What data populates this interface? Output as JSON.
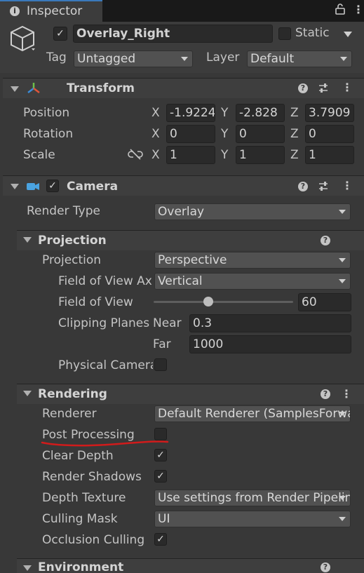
{
  "tab": {
    "title": "Inspector"
  },
  "object": {
    "name": "Overlay_Right",
    "active": true,
    "static_label": "Static",
    "static": false,
    "tag_label": "Tag",
    "tag": "Untagged",
    "layer_label": "Layer",
    "layer": "Default"
  },
  "transform": {
    "title": "Transform",
    "position": {
      "label": "Position",
      "x": "-1.9224",
      "y": "-2.828",
      "z": "3.7909"
    },
    "rotation": {
      "label": "Rotation",
      "x": "0",
      "y": "0",
      "z": "0"
    },
    "scale": {
      "label": "Scale",
      "x": "1",
      "y": "1",
      "z": "1"
    },
    "axes": {
      "x": "X",
      "y": "Y",
      "z": "Z"
    }
  },
  "camera": {
    "title": "Camera",
    "enabled": true,
    "render_type": {
      "label": "Render Type",
      "value": "Overlay"
    },
    "projection": {
      "title": "Projection",
      "projection": {
        "label": "Projection",
        "value": "Perspective"
      },
      "fov_axis": {
        "label": "Field of View Axis",
        "value": "Vertical"
      },
      "fov": {
        "label": "Field of View",
        "value": "60",
        "level": 0.39
      },
      "clipping": {
        "label": "Clipping Planes",
        "near_label": "Near",
        "near": "0.3",
        "far_label": "Far",
        "far": "1000"
      },
      "physical": {
        "label": "Physical Camera",
        "checked": false
      }
    },
    "rendering": {
      "title": "Rendering",
      "renderer": {
        "label": "Renderer",
        "value": "Default Renderer (SamplesForwardRenderer)"
      },
      "post_processing": {
        "label": "Post Processing",
        "checked": false
      },
      "clear_depth": {
        "label": "Clear Depth",
        "checked": true
      },
      "render_shadows": {
        "label": "Render Shadows",
        "checked": true
      },
      "depth_texture": {
        "label": "Depth Texture",
        "value": "Use settings from Render Pipeline Asset"
      },
      "culling_mask": {
        "label": "Culling Mask",
        "value": "UI"
      },
      "occlusion_culling": {
        "label": "Occlusion Culling",
        "checked": true
      }
    },
    "environment": {
      "title": "Environment"
    }
  },
  "colors": {
    "annotation": "#d11b1b",
    "accent": "#3a79bb"
  }
}
